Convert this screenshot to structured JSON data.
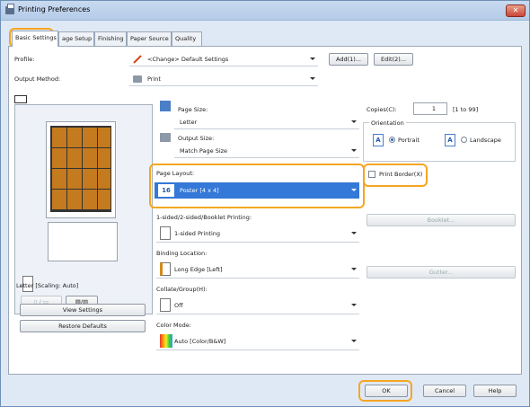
{
  "window": {
    "title": "Printing Preferences",
    "close_icon": "close-icon"
  },
  "tabs": [
    {
      "label": "Basic Settings",
      "active": true
    },
    {
      "label": "age Setup"
    },
    {
      "label": "Finishing"
    },
    {
      "label": "Paper Source"
    },
    {
      "label": "Quality"
    }
  ],
  "profile": {
    "label": "Profile:",
    "value": "<Change> Default Settings",
    "add_button": "Add(1)...",
    "edit_button": "Edit(2)..."
  },
  "output_method": {
    "label": "Output Method:",
    "value": "Print"
  },
  "page_size": {
    "label": "Page Size:",
    "value": "Letter"
  },
  "output_size": {
    "label": "Output Size:",
    "value": "Match Page Size"
  },
  "copies": {
    "label": "Copies(C):",
    "value": "1",
    "range": "[1 to 99]"
  },
  "orientation": {
    "label": "Orientation",
    "portrait": "Portrait",
    "landscape": "Landscape",
    "selected": "Portrait"
  },
  "page_layout": {
    "label": "Page Layout:",
    "icon_text": "16",
    "value": "Poster [4 x 4]"
  },
  "print_border": {
    "label": "Print Border(X)",
    "checked": false
  },
  "sided": {
    "label": "1-sided/2-sided/Booklet Printing:",
    "value": "1-sided Printing",
    "booklet_button": "Booklet..."
  },
  "binding": {
    "label": "Binding Location:",
    "value": "Long Edge [Left]",
    "gutter_button": "Gutter..."
  },
  "collate": {
    "label": "Collate/Group(H):",
    "value": "Off"
  },
  "color_mode": {
    "label": "Color Mode:",
    "value": "Auto [Color/B&W]"
  },
  "preview": {
    "caption": "Letter [Scaling: Auto]"
  },
  "left_buttons": {
    "view_settings": "View Settings",
    "restore_defaults": "Restore Defaults"
  },
  "footer": {
    "ok": "OK",
    "cancel": "Cancel",
    "help": "Help"
  },
  "colors": {
    "highlight": "#f5a623",
    "selection": "#3478d8",
    "photo": "#c47a1e"
  }
}
